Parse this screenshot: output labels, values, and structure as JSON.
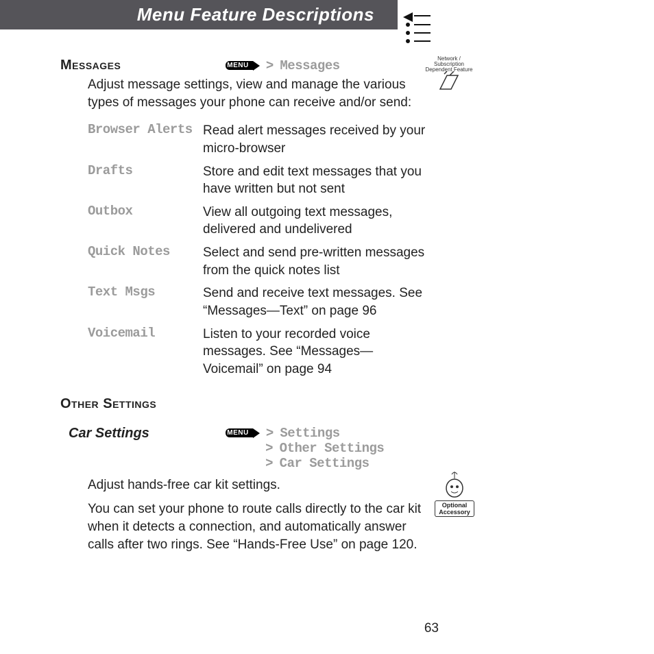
{
  "header": {
    "title": "Menu Feature Descriptions"
  },
  "menuKey": "MENU",
  "messages": {
    "heading": "Messages",
    "path": "Messages",
    "intro": "Adjust message settings, view and manage the various types of messages your phone can receive and/or send:",
    "items": [
      {
        "term": "Browser Alerts",
        "desc": "Read alert messages received by your micro-browser"
      },
      {
        "term": "Drafts",
        "desc": "Store and edit text messages that you have written but not sent"
      },
      {
        "term": "Outbox",
        "desc": "View all outgoing text messages, delivered and undelivered"
      },
      {
        "term": "Quick Notes",
        "desc": "Select and send pre-written messages from the quick notes list"
      },
      {
        "term": "Text Msgs",
        "desc": "Send and receive text messages. See “Messages—Text” on page 96"
      },
      {
        "term": "Voicemail",
        "desc": "Listen to your recorded voice messages. See “Messages—Voicemail” on page 94"
      }
    ]
  },
  "other": {
    "heading": "Other Settings",
    "car": {
      "label": "Car Settings",
      "path": [
        "Settings",
        "Other Settings",
        "Car Settings"
      ],
      "p1": "Adjust hands-free car kit settings.",
      "p2": "You can set your phone to route calls directly to the car kit when it detects a connection, and automatically answer calls after two rings. See “Hands-Free Use” on page 120."
    }
  },
  "sideIcons": {
    "network": "Network / Subscription Dependent Feature",
    "accessory": "Optional Accessory"
  },
  "pageNumber": "63"
}
